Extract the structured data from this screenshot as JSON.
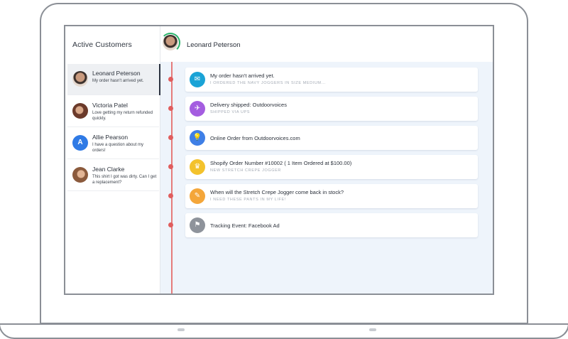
{
  "sidebar": {
    "title": "Active Customers",
    "customers": [
      {
        "name": "Leonard Peterson",
        "message": "My order hasn't arrived yet.",
        "avatar": "photo",
        "active": true
      },
      {
        "name": "Victoria Patel",
        "message": "Love getting my return refunded quickly.",
        "avatar": "photo"
      },
      {
        "name": "Allie Pearson",
        "message": "I have a question about my orders!",
        "avatar": "A"
      },
      {
        "name": "Jean Clarke",
        "message": "This shirt I got was dirty. Can I get a replacement?",
        "avatar": "photo"
      }
    ]
  },
  "header": {
    "name": "Leonard Peterson"
  },
  "events": [
    {
      "title": "My order hasn't arrived yet.",
      "subtitle": "I ORDERED THE NAVY JOGGERS IN SIZE MEDIUM...",
      "icon": "mail-icon",
      "color": "#1aa3d6",
      "glyph": "✉"
    },
    {
      "title": "Delivery shipped: Outdoorvoices",
      "subtitle": "SHIPPED VIA UPS",
      "icon": "airplane-icon",
      "color": "#a45de0",
      "glyph": "✈"
    },
    {
      "title": "Online Order from Outdoorvoices.com",
      "subtitle": "",
      "icon": "lightbulb-icon",
      "color": "#3f7fe6",
      "glyph": "💡"
    },
    {
      "title": "Shopify Order Number #10002 ( 1 Item Ordered at $100.00)",
      "subtitle": "NEW STRETCH CREPE JOGGER",
      "icon": "trophy-icon",
      "color": "#f3c22c",
      "glyph": "♛"
    },
    {
      "title": "When will the Stretch Crepe Jogger come back in stock?",
      "subtitle": "I NEED THESE PANTS IN MY LIFE!",
      "icon": "chat-icon",
      "color": "#f4a63a",
      "glyph": "✎"
    },
    {
      "title": "Tracking Event: Facebook Ad",
      "subtitle": "",
      "icon": "flag-icon",
      "color": "#8e939b",
      "glyph": "⚑"
    }
  ]
}
